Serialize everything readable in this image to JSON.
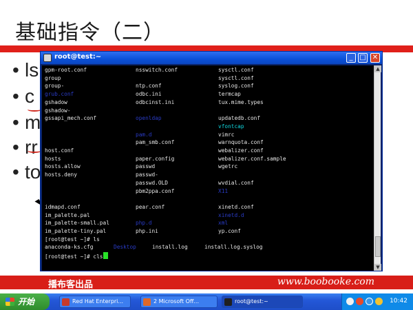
{
  "slide": {
    "title": "基础指令（二）",
    "bullets": [
      "ls",
      "cp",
      "mv",
      "rm",
      "touch"
    ],
    "bullets_visible": [
      "ls",
      "c",
      "m",
      "rr",
      "to"
    ],
    "footer_brand": "播布客出品",
    "footer_url": "www.boobooke.com"
  },
  "window": {
    "title": "root@test:~",
    "buttons": {
      "minimize": "_",
      "maximize": "□",
      "close": "✕"
    }
  },
  "terminal": {
    "rows": [
      [
        {
          "t": "gpm-root.conf",
          "c": ""
        },
        {
          "t": "nsswitch.conf",
          "c": ""
        },
        {
          "t": "sysctl.conf",
          "c": ""
        }
      ],
      [
        {
          "t": "group",
          "c": ""
        },
        {
          "t": "",
          "c": ""
        },
        {
          "t": "sysctl.conf",
          "c": ""
        }
      ],
      [
        {
          "t": "group-",
          "c": ""
        },
        {
          "t": "ntp.conf",
          "c": ""
        },
        {
          "t": "syslog.conf",
          "c": ""
        }
      ],
      [
        {
          "t": "grub.conf",
          "c": "blue"
        },
        {
          "t": "odbc.ini",
          "c": ""
        },
        {
          "t": "termcap",
          "c": ""
        }
      ],
      [
        {
          "t": "gshadow",
          "c": ""
        },
        {
          "t": "odbcinst.ini",
          "c": ""
        },
        {
          "t": "tux.mime.types",
          "c": ""
        }
      ],
      [
        {
          "t": "gshadow-",
          "c": ""
        },
        {
          "t": "",
          "c": ""
        },
        {
          "t": "",
          "c": ""
        }
      ],
      [
        {
          "t": "gssapi_mech.conf",
          "c": ""
        },
        {
          "t": "openldap",
          "c": "blue"
        },
        {
          "t": "updatedb.conf",
          "c": ""
        }
      ],
      [
        {
          "t": "",
          "c": ""
        },
        {
          "t": "",
          "c": ""
        },
        {
          "t": "vfontcap",
          "c": "cyan"
        }
      ],
      [
        {
          "t": "",
          "c": ""
        },
        {
          "t": "pam.d",
          "c": "blue"
        },
        {
          "t": "vimrc",
          "c": ""
        }
      ],
      [
        {
          "t": "",
          "c": ""
        },
        {
          "t": "pam_smb.conf",
          "c": ""
        },
        {
          "t": "warnquota.conf",
          "c": ""
        }
      ],
      [
        {
          "t": "host.conf",
          "c": ""
        },
        {
          "t": "",
          "c": ""
        },
        {
          "t": "webalizer.conf",
          "c": ""
        }
      ],
      [
        {
          "t": "hosts",
          "c": ""
        },
        {
          "t": "paper.config",
          "c": ""
        },
        {
          "t": "webalizer.conf.sample",
          "c": ""
        }
      ],
      [
        {
          "t": "hosts.allow",
          "c": ""
        },
        {
          "t": "passwd",
          "c": ""
        },
        {
          "t": "wgetrc",
          "c": ""
        }
      ],
      [
        {
          "t": "hosts.deny",
          "c": ""
        },
        {
          "t": "passwd-",
          "c": ""
        },
        {
          "t": "",
          "c": ""
        }
      ],
      [
        {
          "t": "",
          "c": ""
        },
        {
          "t": "passwd.OLD",
          "c": ""
        },
        {
          "t": "wvdial.conf",
          "c": ""
        }
      ],
      [
        {
          "t": "",
          "c": ""
        },
        {
          "t": "pbm2ppa.conf",
          "c": ""
        },
        {
          "t": "X11",
          "c": "blue"
        }
      ],
      [
        {
          "t": "",
          "c": ""
        },
        {
          "t": "",
          "c": ""
        },
        {
          "t": "",
          "c": ""
        }
      ],
      [
        {
          "t": "idmapd.conf",
          "c": ""
        },
        {
          "t": "pear.conf",
          "c": ""
        },
        {
          "t": "xinetd.conf",
          "c": ""
        }
      ],
      [
        {
          "t": "im_palette.pal",
          "c": ""
        },
        {
          "t": "",
          "c": ""
        },
        {
          "t": "xinetd.d",
          "c": "blue"
        }
      ],
      [
        {
          "t": "im_palette-small.pal",
          "c": ""
        },
        {
          "t": "php.d",
          "c": "blue"
        },
        {
          "t": "xml",
          "c": "blue"
        }
      ],
      [
        {
          "t": "im_palette-tiny.pal",
          "c": ""
        },
        {
          "t": "php.ini",
          "c": ""
        },
        {
          "t": "yp.conf",
          "c": ""
        }
      ]
    ],
    "prompt1": "[root@test ~]# ls",
    "ls_output": [
      {
        "t": "anaconda-ks.cfg",
        "c": ""
      },
      {
        "t": "Desktop",
        "c": "blue"
      },
      {
        "t": "install.log",
        "c": ""
      },
      {
        "t": "install.log.syslog",
        "c": ""
      },
      {
        "t": "",
        "c": "blue"
      }
    ],
    "prompt2": "[root@test ~]# cls"
  },
  "taskbar": {
    "start_label": "开始",
    "tasks": [
      {
        "label": "Red Hat Enterpri...",
        "active": false
      },
      {
        "label": "2 Microsoft Off...",
        "active": false
      },
      {
        "label": "root@test:~",
        "active": true
      }
    ],
    "clock": "10:42"
  },
  "colors": {
    "accent_red": "#e0201a",
    "terminal_bg": "#000000",
    "dir_blue": "#2a3cc8",
    "exec_green": "#2ad228",
    "link_cyan": "#10d8e0"
  }
}
